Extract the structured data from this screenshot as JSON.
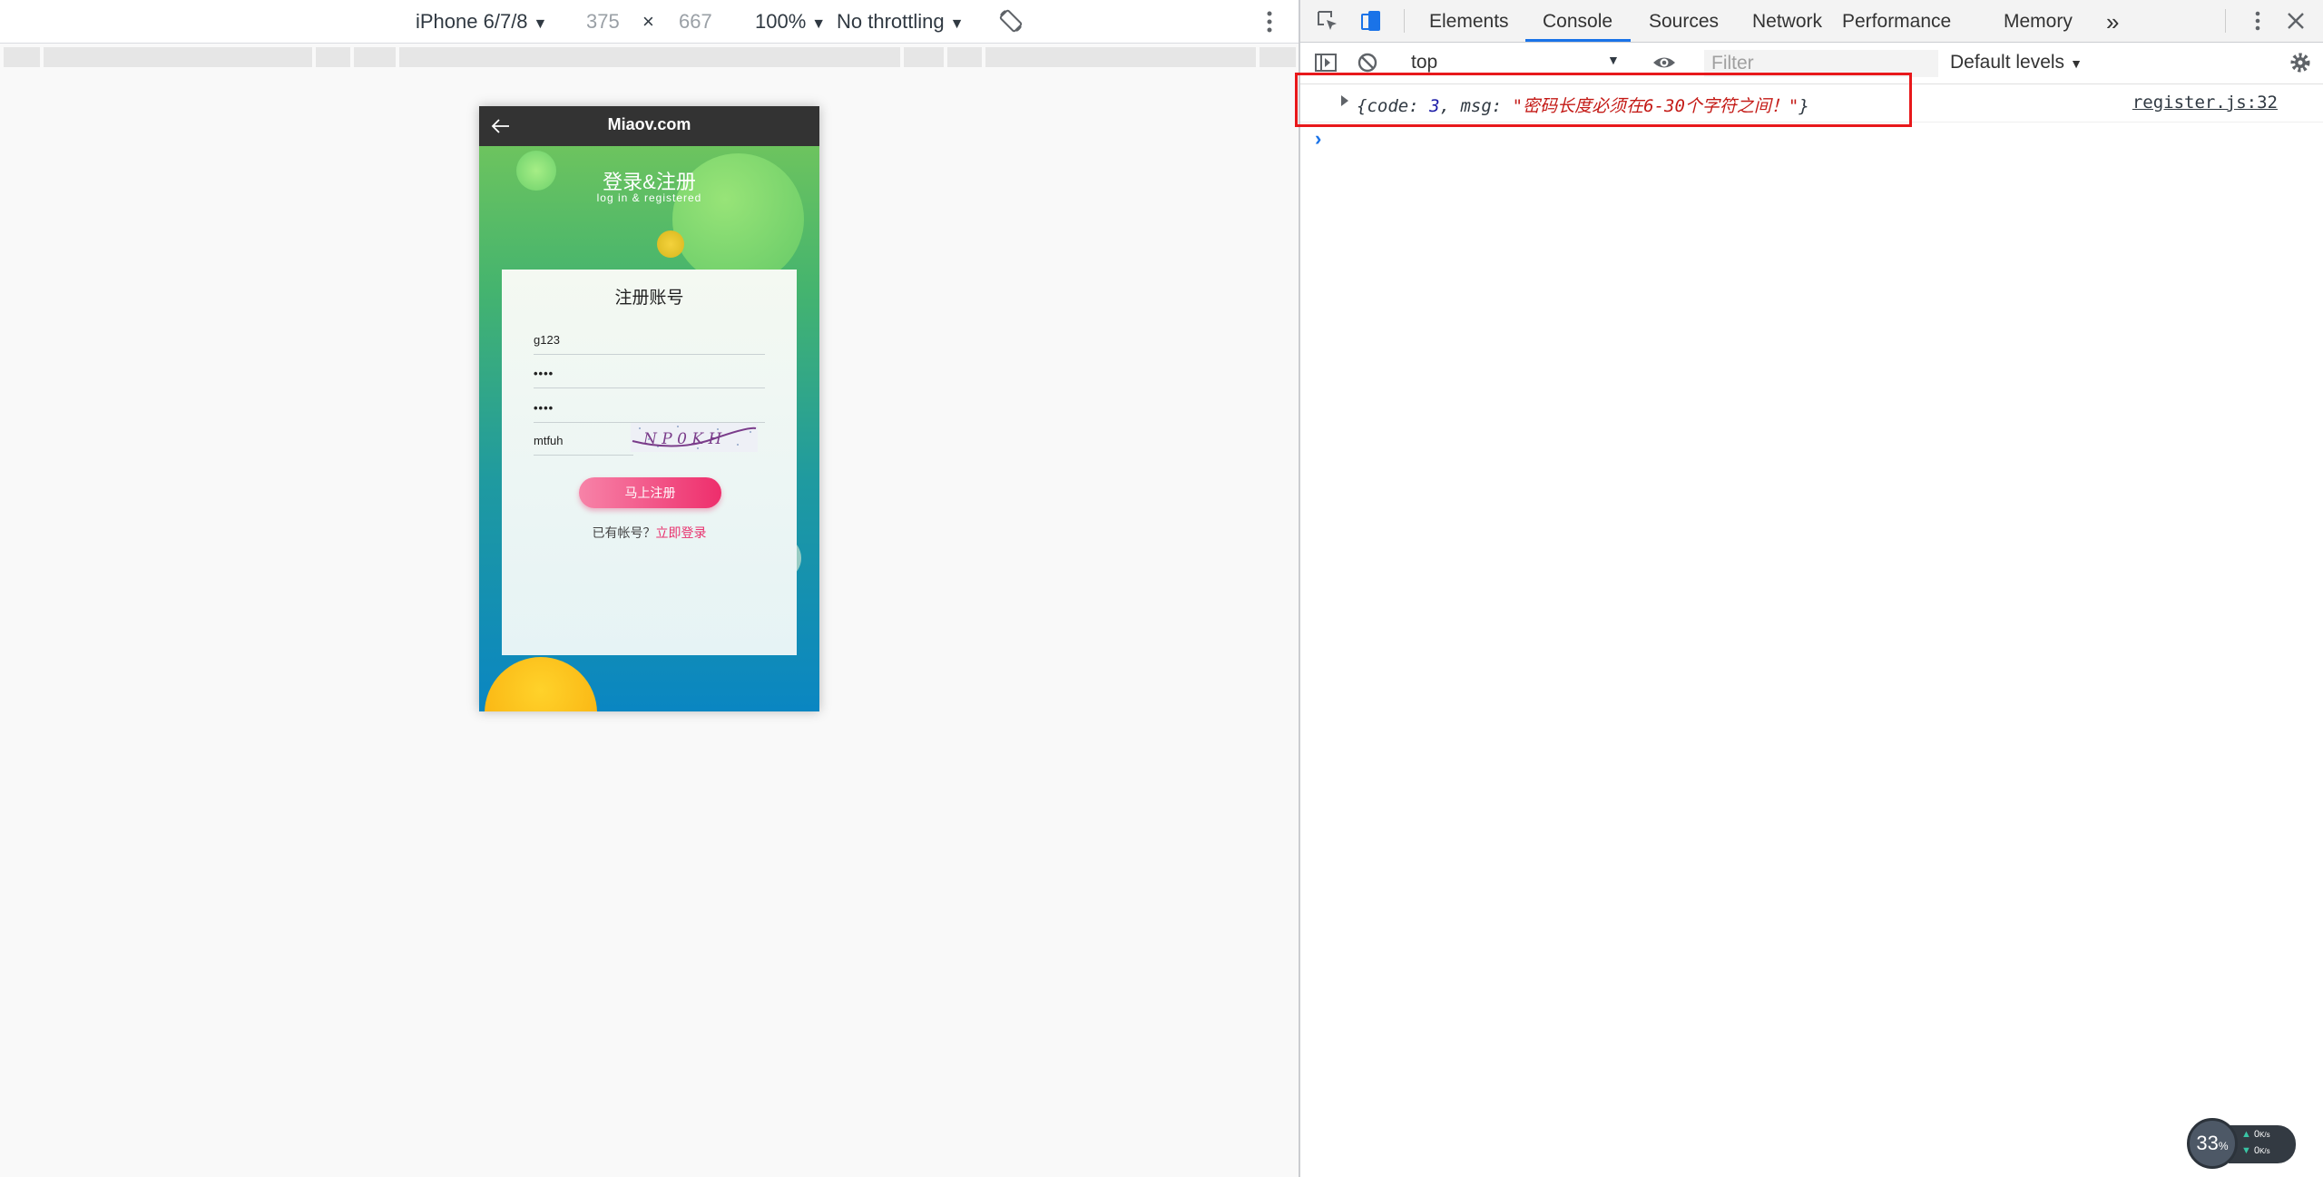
{
  "device_toolbar": {
    "device": "iPhone 6/7/8",
    "width": "375",
    "times": "×",
    "height": "667",
    "zoom": "100%",
    "throttle": "No throttling",
    "icons": [
      "caret-down-icon",
      "rotate-icon",
      "kebab-menu-icon"
    ]
  },
  "phone": {
    "logo": "Miaov.com",
    "hero_title": "登录&注册",
    "hero_subtitle": "log in & registered",
    "card_title": "注册账号",
    "username": "g123",
    "password": "••••",
    "confirm_password": "••••",
    "captcha_input": "mtfuh",
    "captcha_image_text": "N P 0 K H",
    "register_button": "马上注册",
    "have_account": "已有帐号？",
    "login_link": "立即登录"
  },
  "devtools": {
    "tabs": [
      "Elements",
      "Console",
      "Sources",
      "Network",
      "Performance",
      "Memory"
    ],
    "more_tabs": "»",
    "active_tab": "Console",
    "context": "top",
    "filter_placeholder": "Filter",
    "levels": "Default levels",
    "log": {
      "open_brace": "{",
      "key_code": "code",
      "colon_sp": ": ",
      "code_value": "3",
      "comma_sp": ", ",
      "key_msg": "msg",
      "quote": "\"",
      "msg_value": "密码长度必须在6-30个字符之间！",
      "close_brace": "}",
      "source": "register.js:32"
    },
    "prompt": "›"
  },
  "net_widget": {
    "percent": "33",
    "percent_unit": "%",
    "upload": "0",
    "download": "0",
    "rate_unit": "K/s"
  },
  "colors": {
    "accent_blue": "#1a73e8",
    "highlight_red": "#e8181b",
    "register_pink": "#ee2e6c",
    "string_red": "#c41a16",
    "number_blue": "#1a1aa6"
  }
}
